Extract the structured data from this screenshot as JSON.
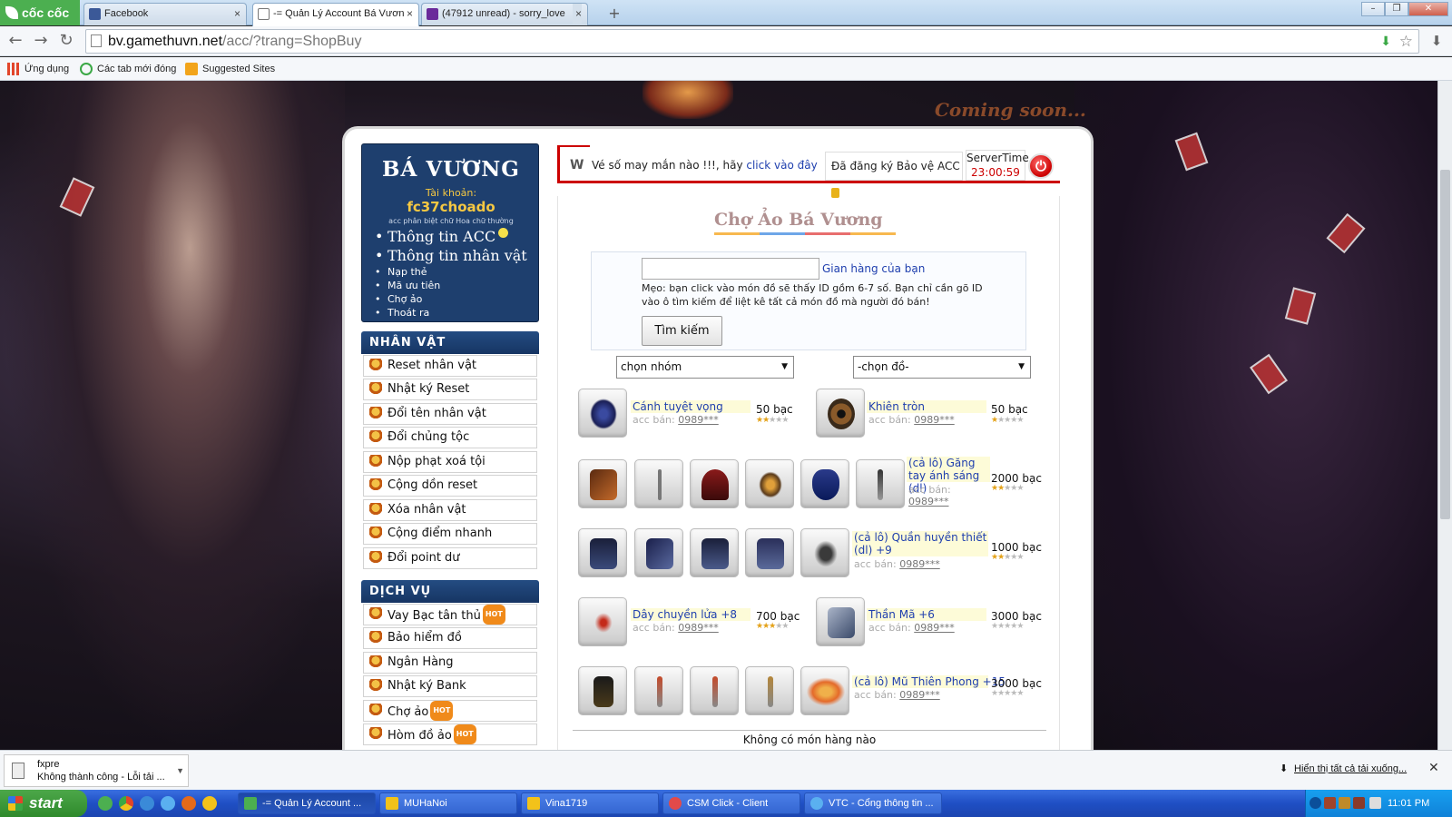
{
  "browser": {
    "logo_text": "cốc cốc",
    "tabs": [
      {
        "label": "Facebook",
        "close": "×"
      },
      {
        "label": "-= Quản Lý Account Bá Vươn",
        "close": "×"
      },
      {
        "label": "(47912 unread) - sorry_love",
        "close": "×"
      }
    ],
    "new_tab": "+",
    "window_buttons": [
      "–",
      "❐",
      "✕"
    ],
    "url_host": "bv.gamethuvn.net",
    "url_path": "/acc/?trang=ShopBuy",
    "bookmarks": [
      "Ứng dụng",
      "Các tab mới đóng",
      "Suggested Sites"
    ]
  },
  "page": {
    "coming_soon": "Coming soon...",
    "account": {
      "game_title": "BÁ VƯƠNG",
      "account_label": "Tài khoản:",
      "account_name": "fc37choado",
      "note": "acc phân biệt chữ Hoa chữ thường",
      "menu": [
        {
          "label": "Thông tin ACC",
          "size": "big"
        },
        {
          "label": "Thông tin nhân vật",
          "size": "big"
        },
        {
          "label": "Nạp thẻ",
          "size": "small"
        },
        {
          "label": "Mã ưu tiên",
          "size": "small"
        },
        {
          "label": "Chợ ảo",
          "size": "small"
        },
        {
          "label": "Thoát ra",
          "size": "small"
        }
      ]
    },
    "sections": [
      {
        "title": "NHÂN VẬT",
        "items": [
          {
            "label": "Reset nhân vật"
          },
          {
            "label": "Nhật ký Reset"
          },
          {
            "label": "Đổi tên nhân vật"
          },
          {
            "label": "Đổi chủng tộc"
          },
          {
            "label": "Nộp phạt xoá tội"
          },
          {
            "label": "Cộng dồn reset"
          },
          {
            "label": "Xóa nhân vật"
          },
          {
            "label": "Cộng điểm nhanh"
          },
          {
            "label": "Đổi point dư"
          }
        ]
      },
      {
        "title": "DỊCH VỤ",
        "items": [
          {
            "label": "Vay Bạc tân thủ",
            "badge": "HOT"
          },
          {
            "label": "Bảo hiểm đồ"
          },
          {
            "label": "Ngân Hàng"
          },
          {
            "label": "Nhật ký Bank"
          },
          {
            "label": "Chợ ảo",
            "badge": "HOT"
          },
          {
            "label": "Hòm đồ ảo",
            "badge": "HOT"
          }
        ]
      }
    ],
    "notice": {
      "icon_text": "W",
      "lucky_text": "Vé số may mắn nào !!!, hãy ",
      "lucky_link": "click vào đây",
      "protect_text": "Đã đăng ký Bảo vệ ACC",
      "servertime_label": "ServerTime",
      "servertime_value": "23:00:59",
      "power_icon": "⏻"
    },
    "market": {
      "title": "Chợ Ảo Bá Vương",
      "search_value": "",
      "my_shop_link": "Gian hàng của bạn",
      "tip": "Mẹo: bạn click vào món đồ sẽ thấy ID gồm 6-7 số. Bạn chỉ cần gõ ID vào ô tìm kiếm để liệt kê tất cả món đồ mà người đó bán!",
      "search_button": "Tìm kiếm",
      "group_select": "chọn nhóm",
      "item_select": "-chọn đồ-",
      "seller_label": "acc bán:",
      "listings": [
        {
          "name": "Cánh tuyệt vọng",
          "seller": "0989***",
          "price": "50 bạc",
          "stars": 2
        },
        {
          "name": "Khiên tròn",
          "seller": "0989***",
          "price": "50 bạc",
          "stars": 1
        },
        {
          "name": "(cả lô) Găng tay ánh sáng (dl)",
          "seller": "0989***",
          "price": "2000 bạc",
          "stars": 2
        },
        {
          "name": "(cả lô) Quần huyền thiết (dl) +9",
          "seller": "0989***",
          "price": "1000 bạc",
          "stars": 2
        },
        {
          "name": "Dây chuyền lửa +8",
          "seller": "0989***",
          "price": "700 bạc",
          "stars": 3
        },
        {
          "name": "Thần Mã +6",
          "seller": "0989***",
          "price": "3000 bạc",
          "stars": 0
        },
        {
          "name": "(cả lô) Mũ Thiên Phong +15",
          "seller": "0989***",
          "price": "3000 bạc",
          "stars": 0
        }
      ],
      "no_items": "Không có món hàng nào"
    }
  },
  "download_shelf": {
    "file_name": "fxpre",
    "status": "Không thành công - Lỗi tải ...",
    "show_all": "Hiển thị tất cả tải xuống...",
    "close": "✕"
  },
  "taskbar": {
    "start_label": "start",
    "buttons": [
      "-= Quản Lý Account ...",
      "MUHaNoi",
      "Vina1719",
      "CSM Click - Client",
      "VTC - Cổng thông tin ..."
    ],
    "clock": "11:01 PM"
  },
  "colors": {
    "accent_blue": "#1e3f6e",
    "link_blue": "#1f3fae",
    "notice_red": "#cc0000",
    "hot_orange": "#f08a1a"
  }
}
